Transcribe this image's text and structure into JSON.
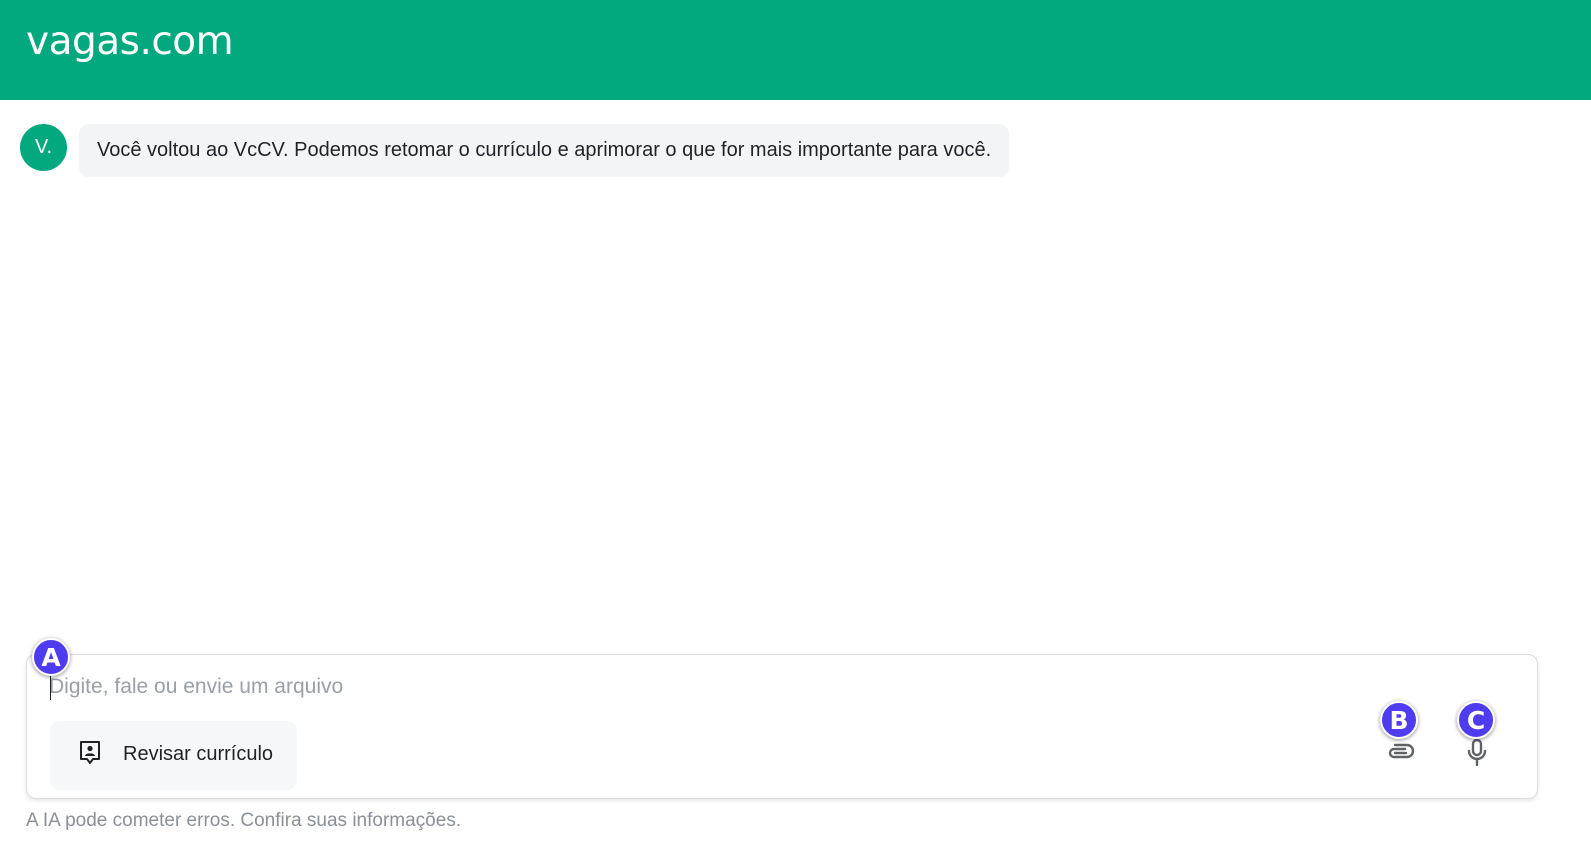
{
  "brand": {
    "logo_text": "vagas.com",
    "color": "#02a97e"
  },
  "chat": {
    "avatar_text": "V.",
    "messages": [
      {
        "sender": "assistant",
        "text": "Você voltou ao VcCV. Podemos retomar o currículo e aprimorar o que for mais importante para você."
      }
    ]
  },
  "composer": {
    "placeholder": "Digite, fale ou envie um arquivo",
    "value": "",
    "review_button_label": "Revisar currículo",
    "review_icon": "resume-icon",
    "attach_icon": "paperclip-icon",
    "mic_icon": "microphone-icon"
  },
  "markers": {
    "a": "A",
    "b": "B",
    "c": "C",
    "color": "#4f3cf0"
  },
  "disclaimer": "A IA pode cometer erros. Confira suas informações."
}
